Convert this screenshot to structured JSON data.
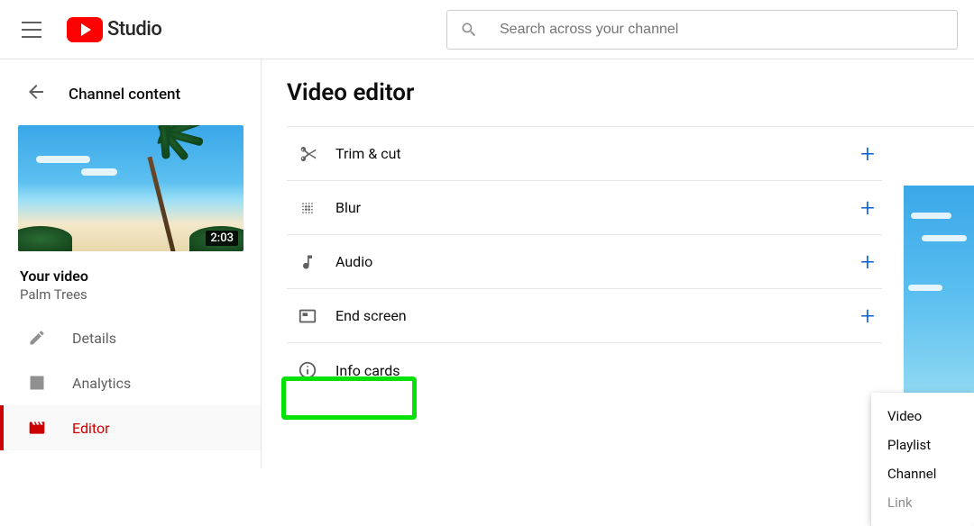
{
  "header": {
    "logo_text": "Studio",
    "search_placeholder": "Search across your channel"
  },
  "sidebar": {
    "back_label": "Channel content",
    "thumb_duration": "2:03",
    "your_video_label": "Your video",
    "video_title": "Palm Trees",
    "nav": [
      {
        "id": "details",
        "label": "Details"
      },
      {
        "id": "analytics",
        "label": "Analytics"
      },
      {
        "id": "editor",
        "label": "Editor"
      }
    ]
  },
  "main": {
    "title": "Video editor",
    "rows": [
      {
        "id": "trim",
        "label": "Trim & cut"
      },
      {
        "id": "blur",
        "label": "Blur"
      },
      {
        "id": "audio",
        "label": "Audio"
      },
      {
        "id": "endscreen",
        "label": "End screen"
      },
      {
        "id": "infocards",
        "label": "Info cards"
      }
    ]
  },
  "info_menu": {
    "items": [
      {
        "id": "video",
        "label": "Video",
        "disabled": false
      },
      {
        "id": "playlist",
        "label": "Playlist",
        "disabled": false
      },
      {
        "id": "channel",
        "label": "Channel",
        "disabled": false
      },
      {
        "id": "link",
        "label": "Link",
        "disabled": true
      }
    ]
  }
}
